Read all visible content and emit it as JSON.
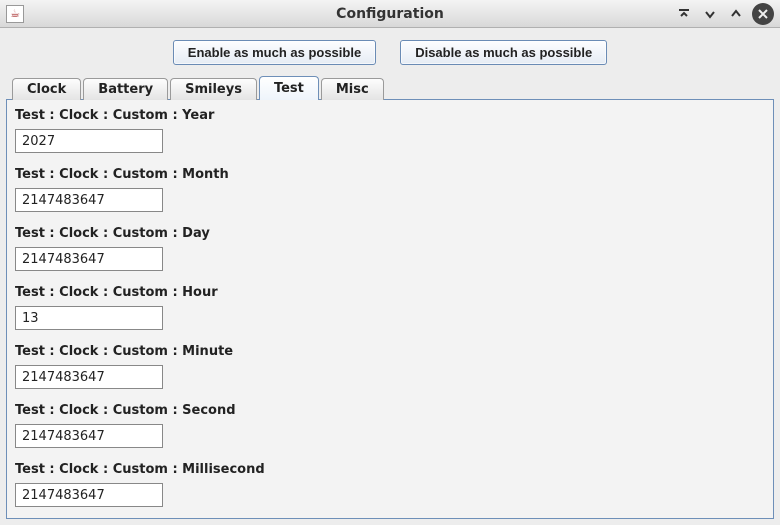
{
  "window": {
    "title": "Configuration"
  },
  "buttons": {
    "enable": "Enable as much as possible",
    "disable": "Disable as much as possible"
  },
  "tabs": [
    {
      "label": "Clock"
    },
    {
      "label": "Battery"
    },
    {
      "label": "Smileys"
    },
    {
      "label": "Test"
    },
    {
      "label": "Misc"
    }
  ],
  "active_tab_index": 3,
  "fields": [
    {
      "label": "Test : Clock : Custom : Year",
      "value": "2027"
    },
    {
      "label": "Test : Clock : Custom : Month",
      "value": "2147483647"
    },
    {
      "label": "Test : Clock : Custom : Day",
      "value": "2147483647"
    },
    {
      "label": "Test : Clock : Custom : Hour",
      "value": "13"
    },
    {
      "label": "Test : Clock : Custom : Minute",
      "value": "2147483647"
    },
    {
      "label": "Test : Clock : Custom : Second",
      "value": "2147483647"
    },
    {
      "label": "Test : Clock : Custom : Millisecond",
      "value": "2147483647"
    }
  ]
}
